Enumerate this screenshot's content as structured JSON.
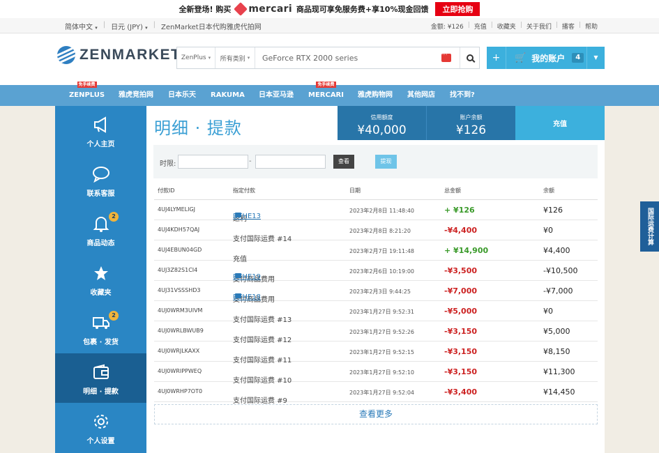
{
  "promo": {
    "text_pre": "全新登场! 购买",
    "brand": "mercari",
    "text_post": "商品现可享免服务费+享10%现金回馈",
    "cta": "立即抢购"
  },
  "topbar": {
    "language": "简体中文",
    "currency": "日元 (JPY)",
    "tagline": "ZenMarket日本代购雅虎代拍网",
    "balance_link": "金额: ¥126",
    "links": [
      "充值",
      "收藏夹",
      "关于我们",
      "播客",
      "帮助"
    ]
  },
  "header": {
    "logo": "ZENMARKET",
    "search_scope": "ZenPlus",
    "search_category": "所有类别",
    "search_query": "GeForce RTX 2000 series",
    "account_plus": "+",
    "account_label": "我的账户",
    "account_count": "4"
  },
  "nav": {
    "free_tag": "免手续费",
    "items": [
      "ZENPLUS",
      "雅虎竞拍网",
      "日本乐天",
      "RAKUMA",
      "日本亚马逊",
      "MERCARI",
      "雅虎购物网",
      "其他网店",
      "找不到?"
    ]
  },
  "sidebar": {
    "items": [
      {
        "label": "个人主页",
        "icon": "megaphone-icon",
        "badge": ""
      },
      {
        "label": "联系客服",
        "icon": "chat-bubble-icon",
        "badge": ""
      },
      {
        "label": "商品动态",
        "icon": "bell-icon",
        "badge": "2"
      },
      {
        "label": "收藏夹",
        "icon": "star-icon",
        "badge": ""
      },
      {
        "label": "包裹 · 发货",
        "icon": "truck-icon",
        "badge": "2"
      },
      {
        "label": "明细 · 提款",
        "icon": "wallet-icon",
        "badge": ""
      },
      {
        "label": "个人设置",
        "icon": "gear-icon",
        "badge": ""
      }
    ]
  },
  "main": {
    "title": "明细 · 提款",
    "credit_label": "信用额度",
    "credit_value": "¥40,000",
    "balance_label": "账户余额",
    "balance_value": "¥126",
    "charge_label": "充值",
    "filter_label": "时限:",
    "filter_dash": "-",
    "view_button": "查看",
    "withdraw_button": "提现",
    "columns": [
      "付款ID",
      "指定付款",
      "日期",
      "总金额",
      "余额"
    ],
    "rows": [
      {
        "id": "4UJ4LYMELIGJ",
        "desc": "返利",
        "link": "DFHE13",
        "date": "2023年2月8日 11:48:40",
        "amount": "+ ¥126",
        "sign": "pos",
        "balance": "¥126"
      },
      {
        "id": "4UJ4KDH57QAJ",
        "desc": "支付国际运费 #14",
        "link": "",
        "date": "2023年2月8日 8:21:20",
        "amount": "-¥4,400",
        "sign": "neg",
        "balance": "¥0"
      },
      {
        "id": "4UJ4EBUN04GD",
        "desc": "充值",
        "link": "",
        "date": "2023年2月7日 19:11:48",
        "amount": "+ ¥14,900",
        "sign": "pos",
        "balance": "¥4,400"
      },
      {
        "id": "4UJ3Z82S1CI4",
        "desc": "支付商品费用",
        "link": "DFHE19",
        "date": "2023年2月6日 10:19:00",
        "amount": "-¥3,500",
        "sign": "neg",
        "balance": "-¥10,500"
      },
      {
        "id": "4UJ31VSSSHD3",
        "desc": "支付商品费用",
        "link": "DFHE18",
        "date": "2023年2月3日 9:44:25",
        "amount": "-¥7,000",
        "sign": "neg",
        "balance": "-¥7,000"
      },
      {
        "id": "4UJ0WRM3UIVM",
        "desc": "支付国际运费 #13",
        "link": "",
        "date": "2023年1月27日 9:52:31",
        "amount": "-¥5,000",
        "sign": "neg",
        "balance": "¥0"
      },
      {
        "id": "4UJ0WRLBWUB9",
        "desc": "支付国际运费 #12",
        "link": "",
        "date": "2023年1月27日 9:52:26",
        "amount": "-¥3,150",
        "sign": "neg",
        "balance": "¥5,000"
      },
      {
        "id": "4UJ0WRJLKAXX",
        "desc": "支付国际运费 #11",
        "link": "",
        "date": "2023年1月27日 9:52:15",
        "amount": "-¥3,150",
        "sign": "neg",
        "balance": "¥8,150"
      },
      {
        "id": "4UJ0WRIPPWEQ",
        "desc": "支付国际运费 #10",
        "link": "",
        "date": "2023年1月27日 9:52:10",
        "amount": "-¥3,150",
        "sign": "neg",
        "balance": "¥11,300"
      },
      {
        "id": "4UJ0WRHP7OT0",
        "desc": "支付国际运费 #9",
        "link": "",
        "date": "2023年1月27日 9:52:04",
        "amount": "-¥3,400",
        "sign": "neg",
        "balance": "¥14,450"
      }
    ],
    "load_more": "查看更多"
  },
  "sidetab": {
    "label": "国际运费计算"
  },
  "colors": {
    "brand_blue": "#2a86c4",
    "nav_blue": "#5aa2d2",
    "accent_cyan": "#3cb0dd",
    "positive": "#3a9a2a",
    "negative": "#cc2222"
  }
}
